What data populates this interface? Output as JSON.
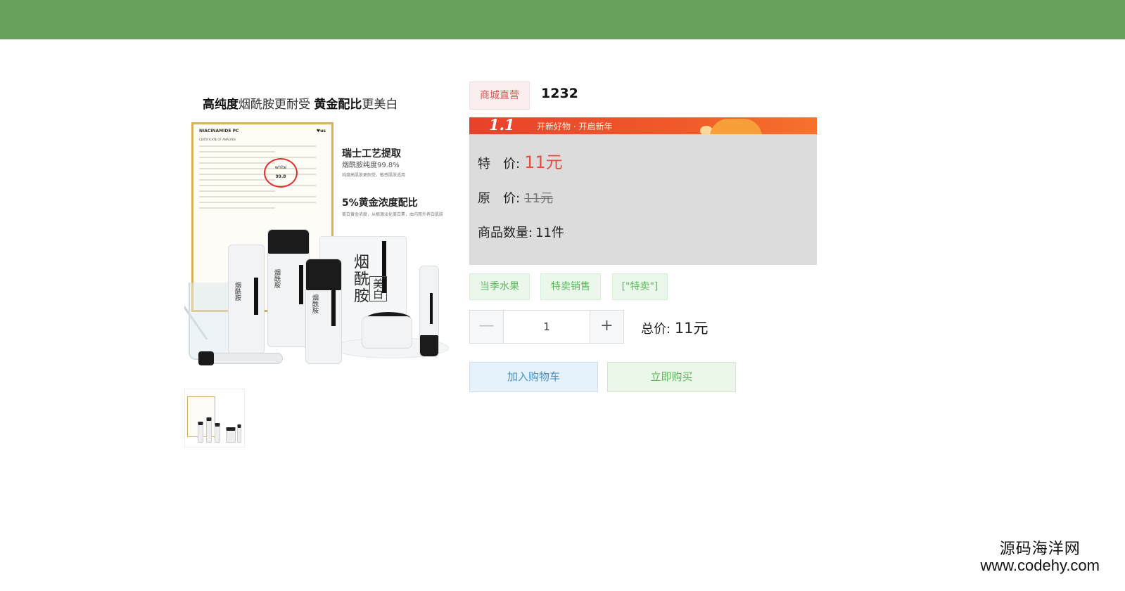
{
  "colors": {
    "topbar": "#68a15c",
    "price_red": "#e74c3c",
    "tag_green": "#5cb85c",
    "cart_blue": "#4a90c8",
    "panel_gray": "#dcdcdc",
    "promo_orange": "#f05a2a"
  },
  "product_image": {
    "headline_bold_1": "高纯度",
    "headline_text_1": "烟酰胺更耐受 ",
    "headline_bold_2": "黄金配比",
    "headline_text_2": "更美白",
    "certificate": {
      "title": "NIACINAMIDE PC",
      "subtitle": "CERTIFICATE OF ANALYSIS",
      "circle_word": "white",
      "circle_value": "99.8"
    },
    "claim_1": {
      "title": "瑞士工艺提取",
      "text": "烟酰胺纯度99.8%",
      "small": "纯度高肌肤更耐受，敏感肌肤适用"
    },
    "claim_2": {
      "title": "5%黄金浓度配比",
      "small": "美白黄金浓度，从根源淡化美白素，由内而外养白肌肤"
    },
    "mask_big": "烟酰胺",
    "mask_small": "美白",
    "bottle_label": "烟酰胺"
  },
  "product": {
    "direct_tag": "商城直营",
    "title": "1232"
  },
  "promo": {
    "number": "1.1",
    "text": "开新好物 · 开启新年"
  },
  "price": {
    "special_label": "特　价:",
    "special_value": "11元",
    "original_label": "原　价:",
    "original_value": "11元",
    "quantity_label": "商品数量:",
    "quantity_value": "11件"
  },
  "tags": [
    "当季水果",
    "特卖销售",
    "[\"特卖\"]"
  ],
  "stepper": {
    "minus": "—",
    "plus": "+",
    "value": "1"
  },
  "total": {
    "label": "总价:",
    "value": "11元"
  },
  "buttons": {
    "add_to_cart": "加入购物车",
    "buy_now": "立即购买"
  },
  "watermark": {
    "cn": "源码海洋网",
    "url": "www.codehy.com"
  }
}
